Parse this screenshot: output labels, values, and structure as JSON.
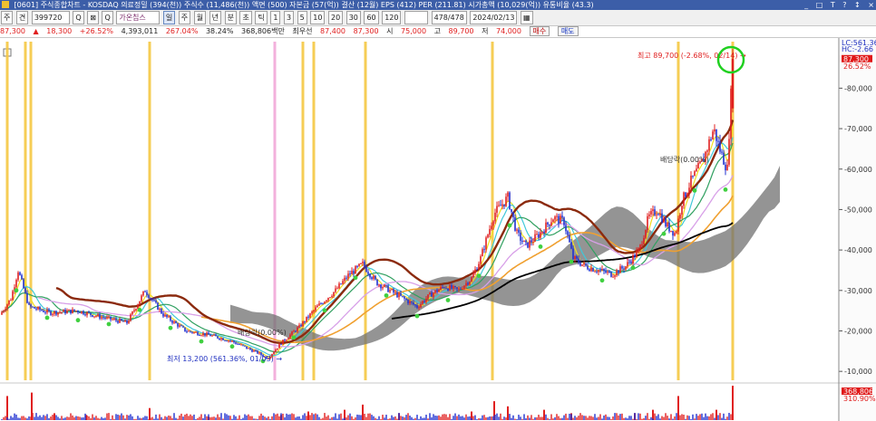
{
  "window": {
    "title": "[0601] 주식종합차트 - KOSDAQ 의료정밀 (394(천)) 주식수 (11,486(천)) 액면 (500) 자본금 (57(억)) 결산 (12월) EPS (412) PER (211.81) 시가총액 (10,029(억)) 유통비율 (43.3)",
    "controls": [
      "_",
      "□",
      "T",
      "?",
      "↕",
      "×"
    ]
  },
  "toolbar": {
    "items": [
      "주",
      "견",
      "399720",
      "Q",
      "⊠",
      "Q",
      "가온칩스",
      "일",
      "주",
      "월",
      "년",
      "분",
      "초",
      "틱",
      "1",
      "3",
      "5",
      "10",
      "20",
      "30",
      "60",
      "120"
    ],
    "count": "478/478",
    "date": "2024/02/13"
  },
  "infobar": {
    "price": "87,300",
    "change": "18,300",
    "change_pct": "+26.52%",
    "volume": "4,393,011",
    "vol_ratio": "267.04%",
    "turnover": "38.24%",
    "amount": "368,806백만",
    "prev_label": "최우선",
    "best_ask": "87,400",
    "best_bid": "87,300",
    "open_label": "시",
    "open": "75,000",
    "high_label": "고",
    "high": "89,700",
    "low_label": "저",
    "low": "74,000",
    "buy_btn": "매수",
    "sell_btn": "매도"
  },
  "chart_data": {
    "type": "candlestick",
    "y_ticks": [
      "80,000",
      "70,000",
      "60,000",
      "50,000",
      "40,000",
      "30,000",
      "20,000",
      "10,000"
    ],
    "ylim": [
      7800,
      91500
    ],
    "last_price_label": "87,300",
    "last_pct_label": "26.52%",
    "lc_label": "LC:561.36",
    "hc_label": "HC:-2.66",
    "annotations": {
      "high": "최고 89,700 (-2.68%, 02/14)",
      "low": "최저 13,200 (561.36%, 01/03)",
      "ex_dividend_1": "배당락(0.00%)",
      "ex_dividend_2": "배당락(0.00%)"
    },
    "close_path": [
      [
        0,
        24000
      ],
      [
        12,
        28000
      ],
      [
        20,
        35000
      ],
      [
        32,
        26000
      ],
      [
        55,
        24500
      ],
      [
        85,
        25000
      ],
      [
        110,
        23500
      ],
      [
        140,
        22000
      ],
      [
        160,
        30000
      ],
      [
        180,
        24000
      ],
      [
        205,
        20000
      ],
      [
        230,
        19000
      ],
      [
        255,
        17500
      ],
      [
        270,
        16000
      ],
      [
        285,
        14500
      ],
      [
        295,
        13200
      ],
      [
        310,
        17000
      ],
      [
        330,
        21000
      ],
      [
        350,
        26000
      ],
      [
        370,
        30000
      ],
      [
        385,
        34000
      ],
      [
        400,
        36500
      ],
      [
        415,
        32000
      ],
      [
        430,
        30000
      ],
      [
        445,
        28000
      ],
      [
        460,
        26000
      ],
      [
        475,
        29000
      ],
      [
        490,
        31000
      ],
      [
        505,
        30000
      ],
      [
        520,
        33000
      ],
      [
        530,
        38000
      ],
      [
        545,
        49000
      ],
      [
        560,
        53000
      ],
      [
        570,
        44000
      ],
      [
        580,
        41000
      ],
      [
        595,
        44000
      ],
      [
        610,
        48000
      ],
      [
        622,
        47000
      ],
      [
        632,
        38000
      ],
      [
        645,
        36000
      ],
      [
        660,
        35000
      ],
      [
        675,
        34000
      ],
      [
        690,
        36000
      ],
      [
        705,
        40000
      ],
      [
        715,
        48000
      ],
      [
        725,
        50000
      ],
      [
        735,
        46000
      ],
      [
        745,
        44000
      ],
      [
        752,
        52000
      ],
      [
        762,
        57000
      ],
      [
        775,
        62000
      ],
      [
        787,
        70000
      ],
      [
        795,
        64000
      ],
      [
        802,
        60000
      ],
      [
        808,
        87300
      ]
    ],
    "volume_bars": [
      [
        8,
        0.7
      ],
      [
        35,
        0.8
      ],
      [
        60,
        0.2
      ],
      [
        95,
        0.15
      ],
      [
        165,
        0.35
      ],
      [
        230,
        0.1
      ],
      [
        310,
        0.15
      ],
      [
        340,
        0.25
      ],
      [
        380,
        0.3
      ],
      [
        400,
        0.45
      ],
      [
        440,
        0.2
      ],
      [
        520,
        0.25
      ],
      [
        545,
        0.55
      ],
      [
        560,
        0.4
      ],
      [
        600,
        0.3
      ],
      [
        630,
        0.2
      ],
      [
        700,
        0.2
      ],
      [
        720,
        0.3
      ],
      [
        748,
        0.7
      ],
      [
        790,
        0.3
      ],
      [
        808,
        1.0
      ]
    ],
    "volume_labels": [
      "368,806",
      "310.90%"
    ],
    "event_lines": [
      {
        "x": 8,
        "color": "#f5c842"
      },
      {
        "x": 28,
        "color": "#f5c842"
      },
      {
        "x": 34,
        "color": "#f5c842"
      },
      {
        "x": 165,
        "color": "#f5c842"
      },
      {
        "x": 303,
        "color": "#f2a8d8"
      },
      {
        "x": 334,
        "color": "#f5c842"
      },
      {
        "x": 346,
        "color": "#f5c842"
      },
      {
        "x": 403,
        "color": "#f5c842"
      },
      {
        "x": 543,
        "color": "#f5c842"
      },
      {
        "x": 748,
        "color": "#f5c842"
      },
      {
        "x": 808,
        "color": "#f5c842"
      }
    ]
  },
  "colors": {
    "up": "#e02020",
    "down": "#2030d0",
    "ma_long": "#8b2a0e",
    "ma_black": "#000000",
    "ma_orange": "#f0a030",
    "cloud": "#707070",
    "marker": "#40d040",
    "highlight_circle": "#20d020"
  }
}
